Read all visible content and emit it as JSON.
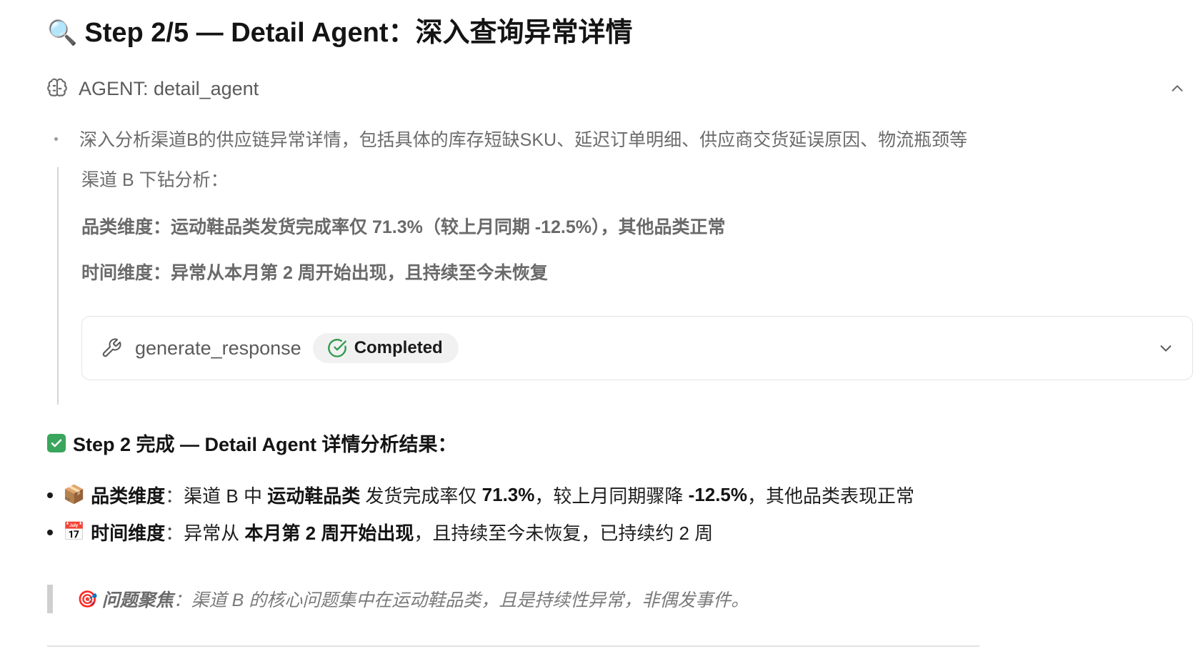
{
  "header": {
    "icon": "magnifier-emoji",
    "icon_glyph": "🔍",
    "title": "Step 2/5 — Detail Agent：深入查询异常详情"
  },
  "agent": {
    "icon": "brain-icon",
    "label": "AGENT: detail_agent",
    "collapse_icon": "chevron-up-icon"
  },
  "task": {
    "description": "深入分析渠道B的供应链异常详情，包括具体的库存短缺SKU、延迟订单明细、供应商交货延误原因、物流瓶颈等"
  },
  "detail": {
    "intro": "渠道 B 下钻分析：",
    "category_line": "品类维度：运动鞋品类发货完成率仅 71.3%（较上月同期 -12.5%），其他品类正常",
    "time_line": "时间维度：异常从本月第 2 周开始出现，且持续至今未恢复"
  },
  "tool": {
    "icon": "wrench-icon",
    "name": "generate_response",
    "status": "Completed",
    "status_color": "#2e9a4e",
    "expand_icon": "chevron-down-icon"
  },
  "result": {
    "check_glyph": "✔",
    "heading": "Step 2 完成 — Detail Agent 详情分析结果：",
    "items": [
      {
        "emoji": "📦",
        "label": "品类维度",
        "colon": "：",
        "t1": "渠道 B 中 ",
        "b1": "运动鞋品类",
        "t2": " 发货完成率仅 ",
        "b2": "71.3%",
        "t3": "，较上月同期骤降 ",
        "b3": "-12.5%",
        "t4": "，其他品类表现正常"
      },
      {
        "emoji": "📅",
        "label": "时间维度",
        "colon": "：",
        "t1": "异常从 ",
        "b1": "本月第 2 周开始出现",
        "t2": "，且持续至今未恢复，已持续约 2 周"
      }
    ]
  },
  "focus": {
    "emoji": "🎯",
    "label": "问题聚焦",
    "colon": "：",
    "text": "渠道 B 的核心问题集中在运动鞋品类，且是持续性异常，非偶发事件。"
  }
}
